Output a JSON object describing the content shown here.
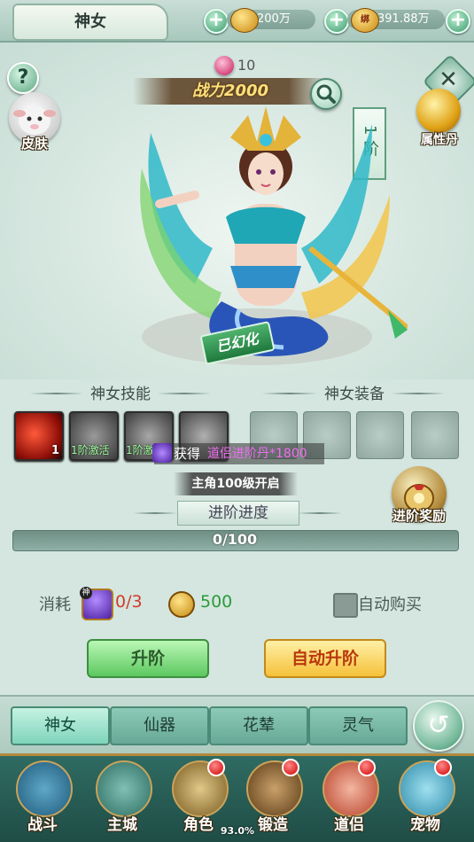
{
  "header": {
    "title": "神女",
    "currency1": {
      "icon": "gold-ingot-icon",
      "value": "200万"
    },
    "currency2": {
      "icon": "bound-gold-icon",
      "tag": "绑",
      "value": "391.88万"
    }
  },
  "hero": {
    "help_label": "?",
    "skin_label": "皮肤",
    "attr_label": "属性丹",
    "level": "10",
    "power": "战力2000",
    "stage": "1阶",
    "morph_badge": "已幻化"
  },
  "skills": {
    "title": "神女技能",
    "slots": [
      {
        "icon": "red-fish-skill-icon",
        "num": "1",
        "label": ""
      },
      {
        "icon": "heart-hands-skill-icon",
        "num": "",
        "label": "1阶激活"
      },
      {
        "icon": "claw-skill-icon",
        "num": "",
        "label": "1阶激活"
      },
      {
        "icon": "swirl-skill-icon",
        "num": "",
        "label": ""
      }
    ]
  },
  "equipment": {
    "title": "神女装备",
    "items": [
      "crown-equip-icon",
      "mirror-equip-icon",
      "jade-ring-equip-icon",
      "necklace-equip-icon"
    ]
  },
  "obtain": {
    "label": "获得",
    "item": "道侣进阶丹*1800"
  },
  "unlock_text": "主角100级开启",
  "reward_label": "进阶奖励",
  "progress": {
    "title": "进阶进度",
    "text": "0/100",
    "current": 0,
    "max": 100
  },
  "cost": {
    "label": "消耗",
    "gem_tag": "神",
    "gem_count": "0/3",
    "coin_count": "500"
  },
  "auto_buy_label": "自动购买",
  "buttons": {
    "upgrade": "升阶",
    "auto_upgrade": "自动升阶"
  },
  "tabs": [
    "神女",
    "仙器",
    "花辇",
    "灵气"
  ],
  "bottom_nav": [
    {
      "label": "战斗",
      "icon": "banner-sword-icon",
      "dot": false
    },
    {
      "label": "主城",
      "icon": "pavilion-icon",
      "dot": false
    },
    {
      "label": "角色",
      "icon": "helmet-icon",
      "dot": true
    },
    {
      "label": "锻造",
      "icon": "anvil-icon",
      "dot": true
    },
    {
      "label": "道侣",
      "icon": "companion-icon",
      "dot": true
    },
    {
      "label": "宠物",
      "icon": "cat-pet-icon",
      "dot": true
    }
  ],
  "percent": "93.0%",
  "colors": {
    "accent_green": "#4fc37d",
    "gold": "#ffe07a",
    "bg": "#d4e6df"
  }
}
